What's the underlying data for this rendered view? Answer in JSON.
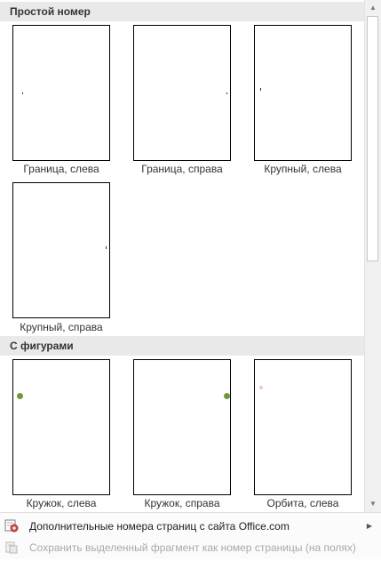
{
  "sections": [
    {
      "title": "Простой номер",
      "items": [
        {
          "label": "Граница, слева"
        },
        {
          "label": "Граница, справа"
        },
        {
          "label": "Крупный, слева"
        },
        {
          "label": "Крупный, справа"
        }
      ]
    },
    {
      "title": "С фигурами",
      "items": [
        {
          "label": "Кружок, слева"
        },
        {
          "label": "Кружок, справа"
        },
        {
          "label": "Орбита, слева"
        }
      ]
    }
  ],
  "footer": {
    "more_label": "Дополнительные номера страниц с сайта Office.com",
    "save_label": "Сохранить выделенный фрагмент как номер страницы (на поляx)"
  },
  "colors": {
    "section_header_bg": "#e9e9e9",
    "circle_dot": "#77933c",
    "orbit_dot": "#f2c4c4"
  },
  "icons": {
    "scroll_up": "scroll-up-arrow-icon",
    "scroll_down": "scroll-down-arrow-icon",
    "more_numbers": "office-online-icon",
    "save_selection": "save-selection-icon",
    "submenu": "submenu-arrow-icon"
  }
}
